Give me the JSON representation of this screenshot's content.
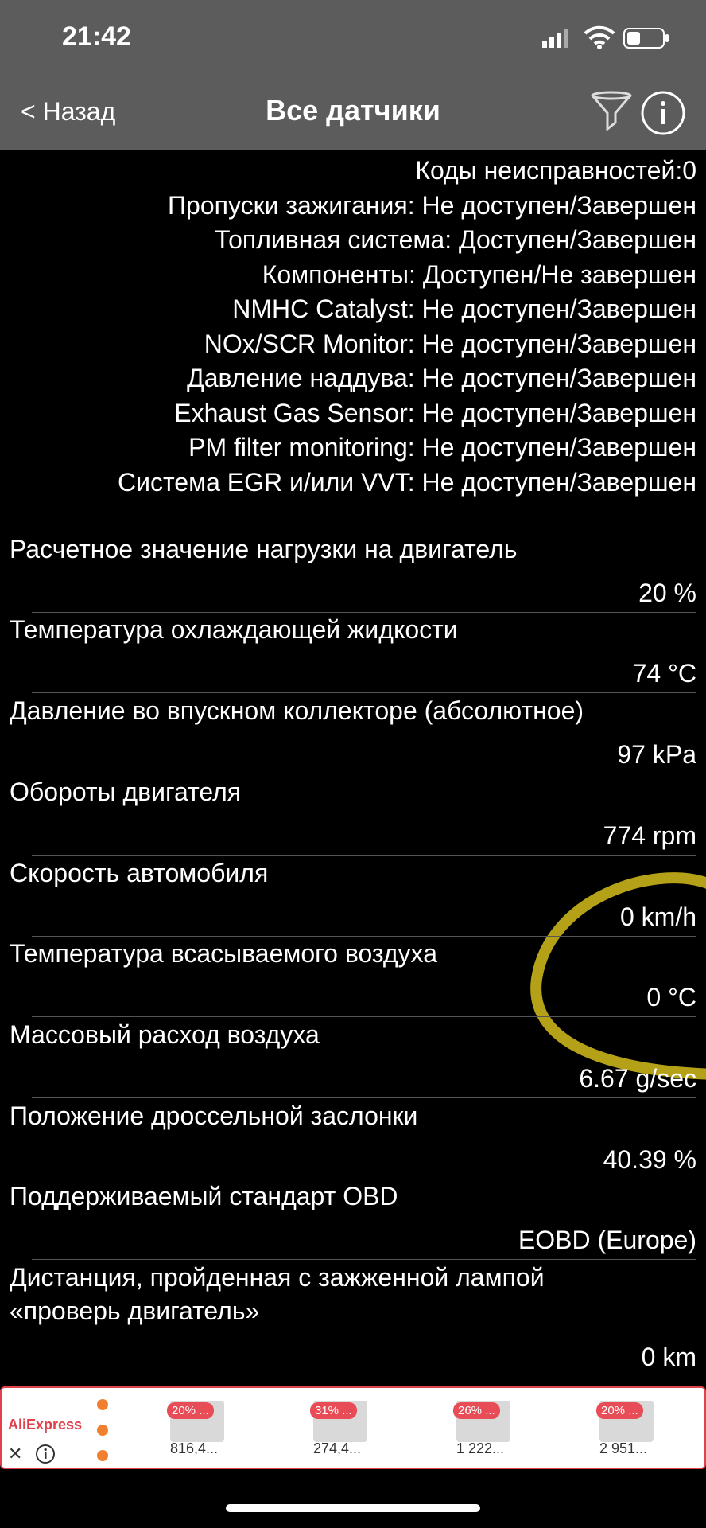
{
  "status_bar": {
    "time": "21:42"
  },
  "nav": {
    "back_label": "< Назад",
    "title": "Все датчики"
  },
  "monitors": [
    "Коды неисправностей:0",
    "Пропуски зажигания: Не доступен/Завершен",
    "Топливная система: Доступен/Завершен",
    "Компоненты: Доступен/Не завершен",
    "NMHC Catalyst: Не доступен/Завершен",
    "NOx/SCR Monitor: Не доступен/Завершен",
    "Давление наддува: Не доступен/Завершен",
    "Exhaust Gas Sensor: Не доступен/Завершен",
    "PM filter monitoring: Не доступен/Завершен",
    "Система EGR и/или VVT: Не доступен/Завершен"
  ],
  "sensors": [
    {
      "name": "Расчетное значение нагрузки на двигатель",
      "value": "20 %"
    },
    {
      "name": "Температура охлаждающей жидкости",
      "value": "74 °C"
    },
    {
      "name": "Давление во впускном коллекторе (абсолютное)",
      "value": "97 kPa"
    },
    {
      "name": "Обороты двигателя",
      "value": "774 rpm"
    },
    {
      "name": "Скорость автомобиля",
      "value": "0 km/h"
    },
    {
      "name": "Температура всасываемого воздуха",
      "value": "0 °C"
    },
    {
      "name": "Массовый расход воздуха",
      "value": "6.67 g/sec"
    },
    {
      "name": "Положение дроссельной заслонки",
      "value": "40.39 %"
    },
    {
      "name": "Поддерживаемый стандарт OBD",
      "value": "EOBD (Europe)"
    },
    {
      "name": "Дистанция, пройденная с зажженной лампой",
      "name2": "«проверь двигатель»",
      "value": "0 km"
    }
  ],
  "ad": {
    "brand": "AliExpress",
    "close": "✕",
    "items": [
      {
        "badge": "20% ...",
        "price": "816,4..."
      },
      {
        "badge": "31% ...",
        "price": "274,4..."
      },
      {
        "badge": "26% ...",
        "price": "1 222..."
      },
      {
        "badge": "20% ...",
        "price": "2 951..."
      }
    ]
  },
  "colors": {
    "header": "#5c5c5c",
    "background": "#000000",
    "highlight": "#c9b21a",
    "ad_accent": "#e0414a"
  }
}
